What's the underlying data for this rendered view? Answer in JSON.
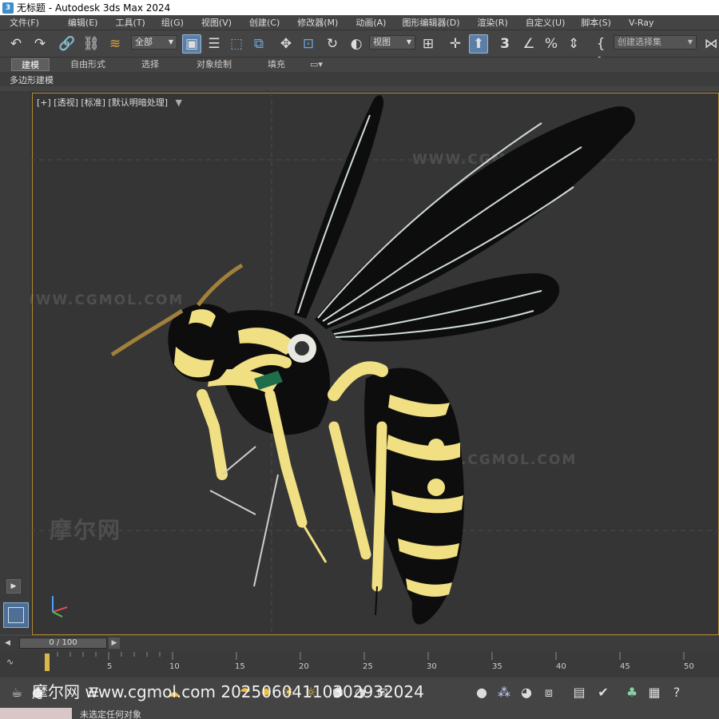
{
  "window": {
    "title": "无标题 - Autodesk 3ds Max 2024",
    "icon": "3"
  },
  "menus": [
    "文件(F)",
    "编辑(E)",
    "工具(T)",
    "组(G)",
    "视图(V)",
    "创建(C)",
    "修改器(M)",
    "动画(A)",
    "图形编辑器(D)",
    "渲染(R)",
    "自定义(U)",
    "脚本(S)",
    "V-Ray"
  ],
  "toolbar": {
    "selection_filter": "全部",
    "reference_coord": "视图",
    "snap_angle_label": "3",
    "named_selection_placeholder": "创建选择集",
    "icons": [
      "undo-icon",
      "redo-icon",
      "link-icon",
      "unlink-icon",
      "bind-spacewarp-icon",
      "select-object-icon",
      "select-by-name-icon",
      "rect-region-icon",
      "window-crossing-icon",
      "move-icon",
      "select-manipulate-icon",
      "rotate-icon",
      "scale-icon",
      "pivot-icon",
      "keyboard-shortcut-icon",
      "snaps-icon",
      "angle-snap-icon",
      "percent-snap-icon",
      "spinner-snap-icon",
      "edit-named-sel-icon",
      "mirror-icon"
    ]
  },
  "ribbon": {
    "tabs": [
      "建模",
      "自由形式",
      "选择",
      "对象绘制",
      "填充"
    ],
    "active_tab": "建模",
    "sub_label": "多边形建模"
  },
  "viewport": {
    "label": "[+] [透视] [标准] [默认明暗处理]",
    "filter_icon": "funnel-icon",
    "watermark_url": "WWW.CGMOL.COM",
    "watermark_logo": "摩尔网"
  },
  "timeline": {
    "frame_display": "0 / 100",
    "ticks": [
      "5",
      "10",
      "15",
      "20",
      "25",
      "30",
      "35",
      "40",
      "45",
      "50"
    ]
  },
  "status": {
    "prompt": "未选定任何对象",
    "overlay_text": "摩尔网 www.cgmol.com 20250604110302932024"
  },
  "colors": {
    "ui_bg": "#444444",
    "viewport_bg": "#353535",
    "viewport_border": "#b08a36",
    "accent_active": "#5b7fa6",
    "wasp_black": "#0d0d0d",
    "wasp_yellow": "#f1df83"
  }
}
